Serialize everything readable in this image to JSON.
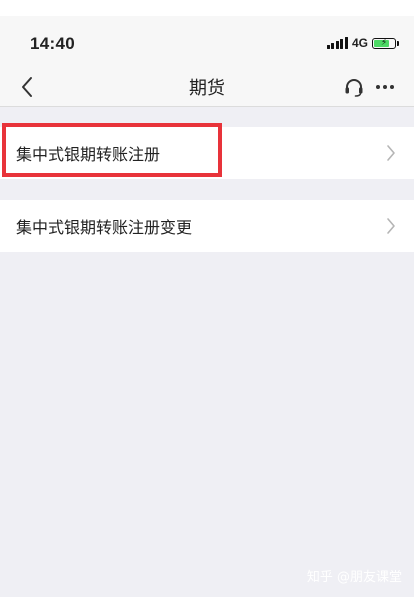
{
  "status_bar": {
    "time": "14:40",
    "network": "4G",
    "battery_level": 0.8,
    "icons": [
      "signal-icon",
      "battery-icon"
    ]
  },
  "nav": {
    "title": "期货",
    "back_icon": "chevron-left-icon",
    "service_icon": "headset-icon",
    "more_icon": "more-dots-icon"
  },
  "menu": {
    "items": [
      {
        "label": "集中式银期转账注册",
        "icon": "chevron-right-icon",
        "highlighted": true
      },
      {
        "label": "集中式银期转账注册变更",
        "icon": "chevron-right-icon",
        "highlighted": false
      }
    ]
  },
  "watermark": "知乎 @朋友课堂",
  "colors": {
    "highlight": "#e8333a",
    "background": "#efeff4",
    "nav_background": "#f7f7f7",
    "battery": "#4cd964"
  }
}
